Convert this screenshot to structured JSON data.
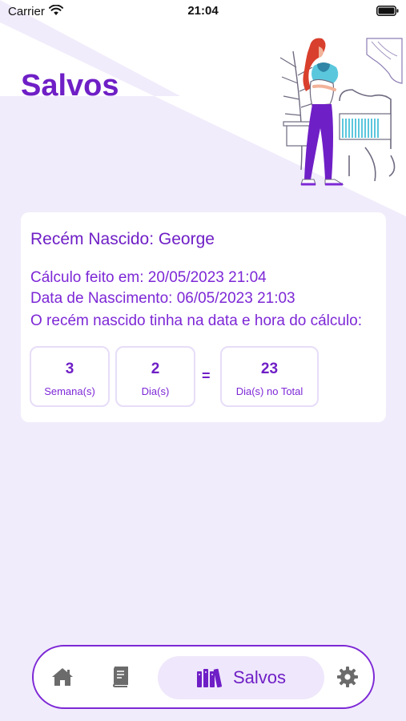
{
  "status_bar": {
    "carrier": "Carrier",
    "time": "21:04",
    "wifi_icon": "wifi-icon",
    "battery_icon": "battery-icon"
  },
  "page": {
    "title": "Salvos"
  },
  "colors": {
    "accent": "#6f1fc6",
    "text_purple": "#7d28d6",
    "background": "#f1ecfb",
    "background_diagonal": "#ece5f9",
    "card": "#ffffff",
    "stat_border": "#e7ddf8"
  },
  "saved_card": {
    "title": "Recém Nascido: George",
    "calc_line": "Cálculo feito em: 20/05/2023 21:04",
    "birth_line": "Data de Nascimento: 06/05/2023 21:03",
    "summary_line": "O recém nascido tinha na data e hora do cálculo:",
    "stats": {
      "weeks": {
        "value": "3",
        "label": "Semana(s)"
      },
      "days": {
        "value": "2",
        "label": "Dia(s)"
      },
      "equals": "=",
      "total": {
        "value": "23",
        "label": "Dia(s) no Total"
      }
    }
  },
  "tab_bar": {
    "items": [
      {
        "icon": "home-icon",
        "active": false
      },
      {
        "icon": "book-icon",
        "active": false
      },
      {
        "icon": "library-icon",
        "label": "Salvos",
        "active": true
      },
      {
        "icon": "gear-icon",
        "active": false
      }
    ]
  }
}
